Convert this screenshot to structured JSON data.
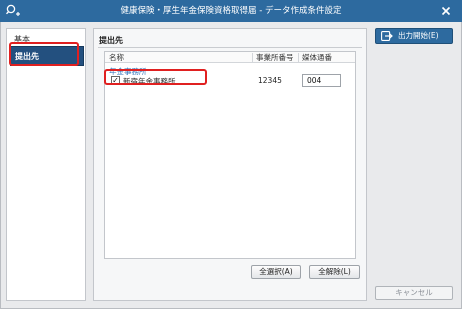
{
  "titlebar": {
    "title": "健康保険・厚生年金保険資格取得届 - データ作成条件設定",
    "app_icon": "search-plus-icon",
    "close_icon": "close-icon"
  },
  "sidebar": {
    "items": [
      {
        "label": "基本",
        "selected": false
      },
      {
        "label": "提出先",
        "selected": true
      }
    ]
  },
  "main": {
    "section_title": "提出先",
    "columns": [
      "名称",
      "事業所番号",
      "媒体通番"
    ],
    "group_label": "年金事務所",
    "rows": [
      {
        "checked": true,
        "check_mark": "✓",
        "name": "新宿年金事務所",
        "office_number": "12345",
        "media_serial": "004"
      }
    ],
    "select_all_label": "全選択(A)",
    "clear_all_label": "全解除(L)"
  },
  "actions": {
    "output_label": "出力開始(E)",
    "cancel_label": "キャンセル"
  },
  "colors": {
    "titlebar": "#2d6a9f",
    "selected_nav": "#23507f",
    "highlight": "#e02020",
    "group_text": "#2a6fb8"
  }
}
